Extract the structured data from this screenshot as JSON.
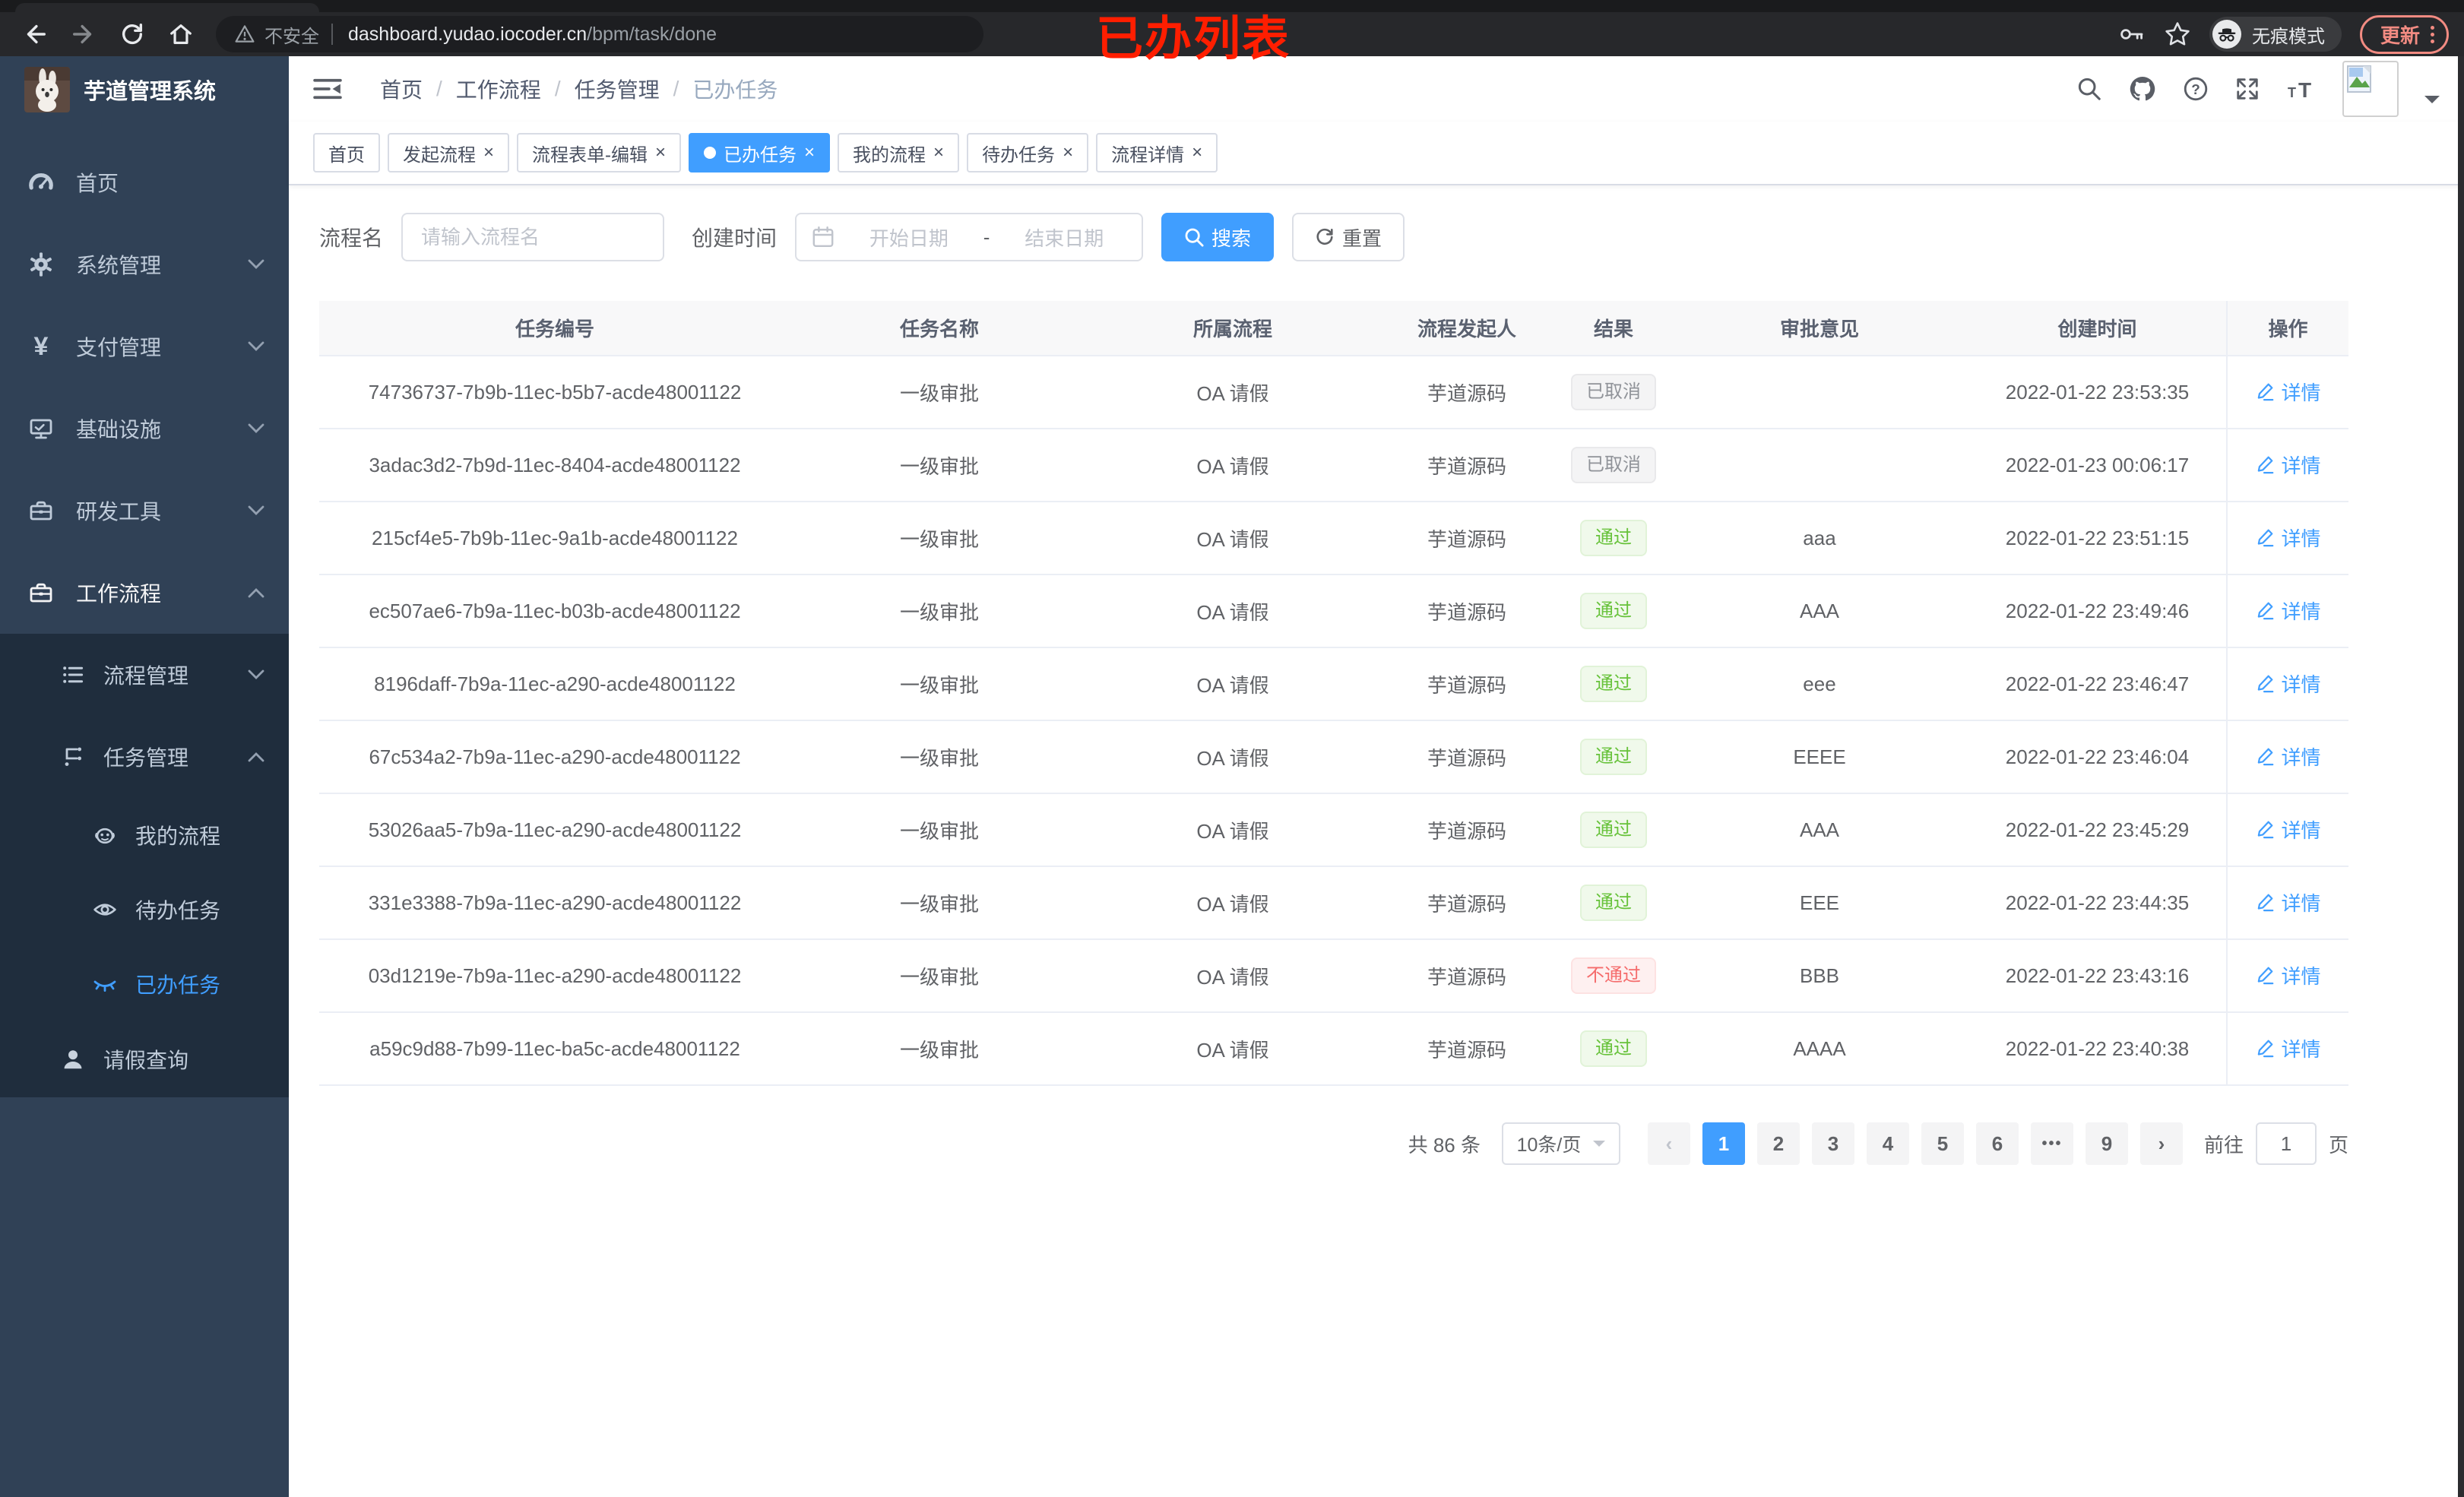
{
  "colors": {
    "accent": "#409eff",
    "success": "#67c23a",
    "danger": "#f56c6c",
    "info": "#909399",
    "sidebar_bg": "#304156",
    "submenu_bg": "#1f2d3d",
    "update": "#f28b82"
  },
  "icons": {
    "close": "×",
    "chevron_left": "‹",
    "chevron_right": "›",
    "yen": "¥",
    "font_small": "T",
    "font_big": "T",
    "question": "?"
  },
  "browser": {
    "security_label": "不安全",
    "url_host": "dashboard.yudao.iocoder.cn",
    "url_path": "/bpm/task/done",
    "incognito_label": "无痕模式",
    "update_label": "更新"
  },
  "annotation": {
    "title": "已办列表"
  },
  "sidebar": {
    "app_title": "芋道管理系统",
    "items": [
      {
        "label": "首页"
      },
      {
        "label": "系统管理",
        "chevron": "down"
      },
      {
        "label": "支付管理",
        "chevron": "down"
      },
      {
        "label": "基础设施",
        "chevron": "down"
      },
      {
        "label": "研发工具",
        "chevron": "down"
      },
      {
        "label": "工作流程",
        "chevron": "up",
        "active": true
      }
    ],
    "submenu": [
      {
        "label": "流程管理",
        "chevron": "down"
      },
      {
        "label": "任务管理",
        "chevron": "up"
      },
      {
        "label": "我的流程"
      },
      {
        "label": "待办任务"
      },
      {
        "label": "已办任务",
        "active": true
      },
      {
        "label": "请假查询"
      }
    ]
  },
  "header": {
    "breadcrumb": [
      "首页",
      "工作流程",
      "任务管理",
      "已办任务"
    ],
    "breadcrumb_separator": "/"
  },
  "tabs": [
    {
      "label": "首页",
      "closable": false
    },
    {
      "label": "发起流程",
      "closable": true
    },
    {
      "label": "流程表单-编辑",
      "closable": true
    },
    {
      "label": "已办任务",
      "closable": true,
      "active": true
    },
    {
      "label": "我的流程",
      "closable": true
    },
    {
      "label": "待办任务",
      "closable": true
    },
    {
      "label": "流程详情",
      "closable": true
    }
  ],
  "filters": {
    "name_label": "流程名",
    "name_placeholder": "请输入流程名",
    "time_label": "创建时间",
    "start_placeholder": "开始日期",
    "date_separator": "-",
    "end_placeholder": "结束日期",
    "search_label": "搜索",
    "reset_label": "重置"
  },
  "table": {
    "columns": [
      "任务编号",
      "任务名称",
      "所属流程",
      "流程发起人",
      "结果",
      "审批意见",
      "创建时间",
      "操作"
    ],
    "action_label": "详情",
    "rows": [
      {
        "id": "74736737-7b9b-11ec-b5b7-acde48001122",
        "name": "一级审批",
        "process": "OA 请假",
        "starter": "芋道源码",
        "result": "已取消",
        "result_type": "info",
        "comment": "",
        "created": "2022-01-22 23:53:35"
      },
      {
        "id": "3adac3d2-7b9d-11ec-8404-acde48001122",
        "name": "一级审批",
        "process": "OA 请假",
        "starter": "芋道源码",
        "result": "已取消",
        "result_type": "info",
        "comment": "",
        "created": "2022-01-23 00:06:17"
      },
      {
        "id": "215cf4e5-7b9b-11ec-9a1b-acde48001122",
        "name": "一级审批",
        "process": "OA 请假",
        "starter": "芋道源码",
        "result": "通过",
        "result_type": "success",
        "comment": "aaa",
        "created": "2022-01-22 23:51:15"
      },
      {
        "id": "ec507ae6-7b9a-11ec-b03b-acde48001122",
        "name": "一级审批",
        "process": "OA 请假",
        "starter": "芋道源码",
        "result": "通过",
        "result_type": "success",
        "comment": "AAA",
        "created": "2022-01-22 23:49:46"
      },
      {
        "id": "8196daff-7b9a-11ec-a290-acde48001122",
        "name": "一级审批",
        "process": "OA 请假",
        "starter": "芋道源码",
        "result": "通过",
        "result_type": "success",
        "comment": "eee",
        "created": "2022-01-22 23:46:47"
      },
      {
        "id": "67c534a2-7b9a-11ec-a290-acde48001122",
        "name": "一级审批",
        "process": "OA 请假",
        "starter": "芋道源码",
        "result": "通过",
        "result_type": "success",
        "comment": "EEEE",
        "created": "2022-01-22 23:46:04"
      },
      {
        "id": "53026aa5-7b9a-11ec-a290-acde48001122",
        "name": "一级审批",
        "process": "OA 请假",
        "starter": "芋道源码",
        "result": "通过",
        "result_type": "success",
        "comment": "AAA",
        "created": "2022-01-22 23:45:29"
      },
      {
        "id": "331e3388-7b9a-11ec-a290-acde48001122",
        "name": "一级审批",
        "process": "OA 请假",
        "starter": "芋道源码",
        "result": "通过",
        "result_type": "success",
        "comment": "EEE",
        "created": "2022-01-22 23:44:35"
      },
      {
        "id": "03d1219e-7b9a-11ec-a290-acde48001122",
        "name": "一级审批",
        "process": "OA 请假",
        "starter": "芋道源码",
        "result": "不通过",
        "result_type": "danger",
        "comment": "BBB",
        "created": "2022-01-22 23:43:16"
      },
      {
        "id": "a59c9d88-7b99-11ec-ba5c-acde48001122",
        "name": "一级审批",
        "process": "OA 请假",
        "starter": "芋道源码",
        "result": "通过",
        "result_type": "success",
        "comment": "AAAA",
        "created": "2022-01-22 23:40:38"
      }
    ]
  },
  "pagination": {
    "total_label": "共 86 条",
    "page_size": "10条/页",
    "pages": [
      "1",
      "2",
      "3",
      "4",
      "5",
      "6",
      "•••",
      "9"
    ],
    "active_page": "1",
    "goto_label": "前往",
    "goto_value": "1",
    "goto_unit": "页"
  }
}
